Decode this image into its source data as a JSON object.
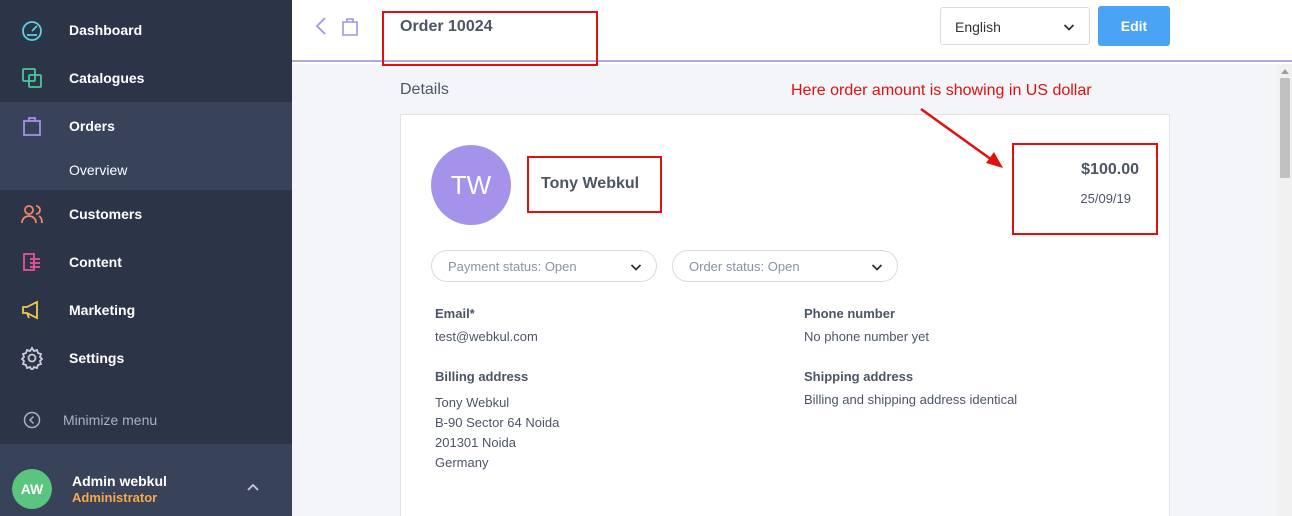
{
  "sidebar": {
    "items": [
      {
        "label": "Dashboard",
        "icon": "dashboard-icon"
      },
      {
        "label": "Catalogues",
        "icon": "catalogues-icon"
      },
      {
        "label": "Orders",
        "icon": "orders-icon"
      },
      {
        "label": "Customers",
        "icon": "customers-icon"
      },
      {
        "label": "Content",
        "icon": "content-icon"
      },
      {
        "label": "Marketing",
        "icon": "marketing-icon"
      },
      {
        "label": "Settings",
        "icon": "settings-icon"
      }
    ],
    "sub_item": "Overview",
    "minimize_label": "Minimize menu",
    "user": {
      "initials": "AW",
      "name": "Admin webkul",
      "role": "Administrator"
    }
  },
  "header": {
    "title": "Order 10024",
    "language": "English",
    "edit_label": "Edit"
  },
  "main": {
    "section_title": "Details",
    "customer": {
      "initials": "TW",
      "name": "Tony Webkul"
    },
    "amount": "$100.00",
    "date": "25/09/19",
    "payment_status": "Payment status: Open",
    "order_status": "Order status: Open",
    "email_label": "Email*",
    "email_value": "test@webkul.com",
    "phone_label": "Phone number",
    "phone_value": "No phone number yet",
    "billing_label": "Billing address",
    "billing_lines": [
      "Tony Webkul",
      "B-90 Sector 64 Noida",
      "201301 Noida",
      "Germany"
    ],
    "shipping_label": "Shipping address",
    "shipping_value": "Billing and shipping address identical"
  },
  "annotation": {
    "text": "Here order amount is showing in US dollar",
    "color": "#e01010"
  },
  "colors": {
    "sidebar_bg": "#2c3548",
    "accent_blue": "#4aa3f5",
    "avatar_purple": "#a592ea",
    "user_avatar_green": "#5ac57f",
    "role_orange": "#f6a94a"
  }
}
